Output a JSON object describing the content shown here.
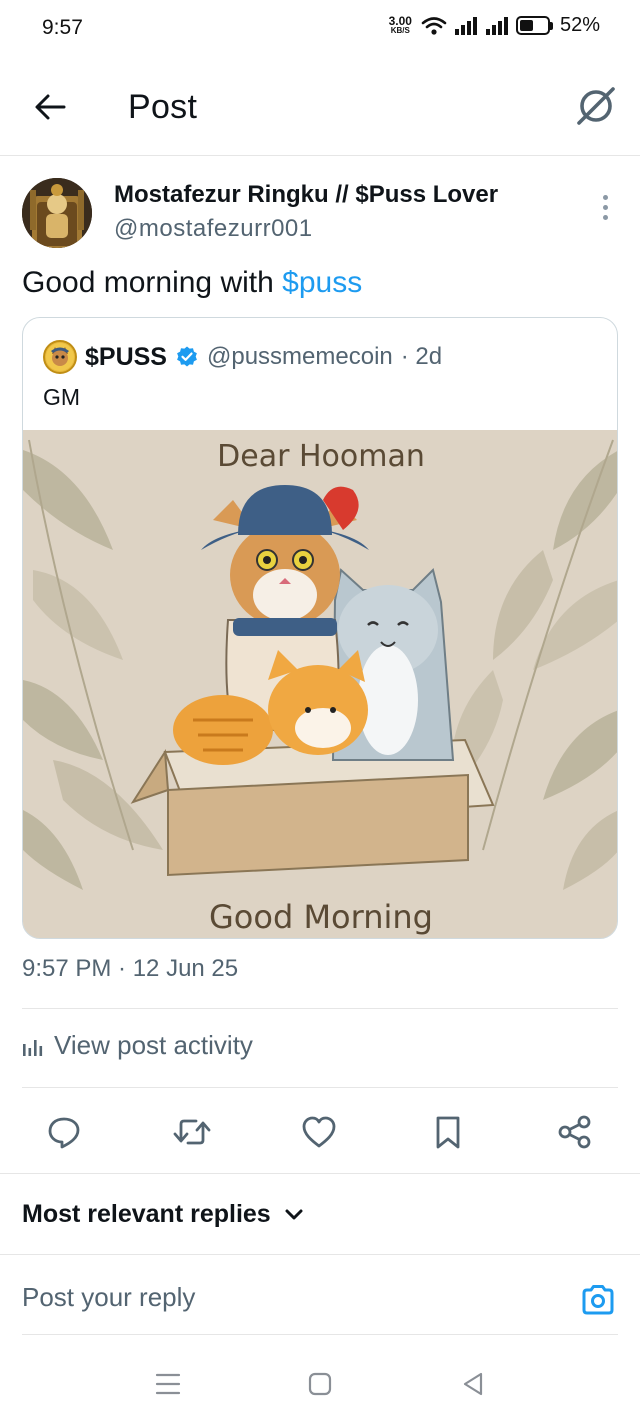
{
  "status_bar": {
    "time": "9:57",
    "net_speed_value": "3.00",
    "net_speed_unit": "KB/S",
    "battery_text": "52%",
    "battery_level": 0.52
  },
  "header": {
    "title": "Post",
    "back_icon": "arrow-left-icon",
    "grok_icon": "grok-icon"
  },
  "post": {
    "author_name": "Mostafezur Ringku // $Puss Lover",
    "author_handle": "@mostafezurr001",
    "text": "Good morning with ",
    "hashtag": "$puss",
    "timestamp": "9:57 PM · 12 Jun 25"
  },
  "quote": {
    "name": "$PUSS",
    "handle": "@pussmemecoin",
    "age": "· 2d",
    "body": "GM",
    "image_top_text": "Dear Hooman",
    "image_bottom_text": "Good Morning",
    "verified_color": "#1d9bf0"
  },
  "activity": {
    "label": "View post activity"
  },
  "actions": {
    "reply": "reply-icon",
    "repost": "repost-icon",
    "like": "heart-icon",
    "bookmark": "bookmark-icon",
    "share": "share-icon"
  },
  "replies": {
    "sort_label": "Most relevant replies",
    "input_placeholder": "Post your reply"
  },
  "colors": {
    "accent": "#1d9bf0",
    "secondary_text": "#536471",
    "border": "#cfd9de"
  }
}
